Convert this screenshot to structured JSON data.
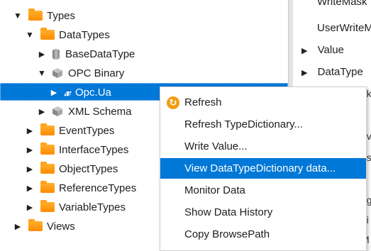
{
  "tree": {
    "items": [
      {
        "label": "Types"
      },
      {
        "label": "DataTypes"
      },
      {
        "label": "BaseDataType"
      },
      {
        "label": "OPC Binary"
      },
      {
        "label": "Opc.Ua"
      },
      {
        "label": "XML Schema"
      },
      {
        "label": "EventTypes"
      },
      {
        "label": "InterfaceTypes"
      },
      {
        "label": "ObjectTypes"
      },
      {
        "label": "ReferenceTypes"
      },
      {
        "label": "VariableTypes"
      },
      {
        "label": "Views"
      }
    ]
  },
  "right_panel": {
    "rows": [
      {
        "label": "WriteMask"
      },
      {
        "label": "UserWriteM"
      },
      {
        "label": "Value"
      },
      {
        "label": "DataType"
      }
    ],
    "fragments": [
      "nk",
      "e",
      "ev",
      "es",
      "n",
      "ng",
      "ni",
      "M"
    ]
  },
  "context_menu": {
    "items": [
      {
        "label": "Refresh"
      },
      {
        "label": "Refresh TypeDictionary..."
      },
      {
        "label": "Write Value..."
      },
      {
        "label": "View DataTypeDictionary data..."
      },
      {
        "label": "Monitor Data"
      },
      {
        "label": "Show Data History"
      },
      {
        "label": "Copy BrowsePath"
      }
    ]
  },
  "colors": {
    "selection": "#0078d7",
    "folder": "#ff9800",
    "refresh_icon": "#f39c12"
  }
}
